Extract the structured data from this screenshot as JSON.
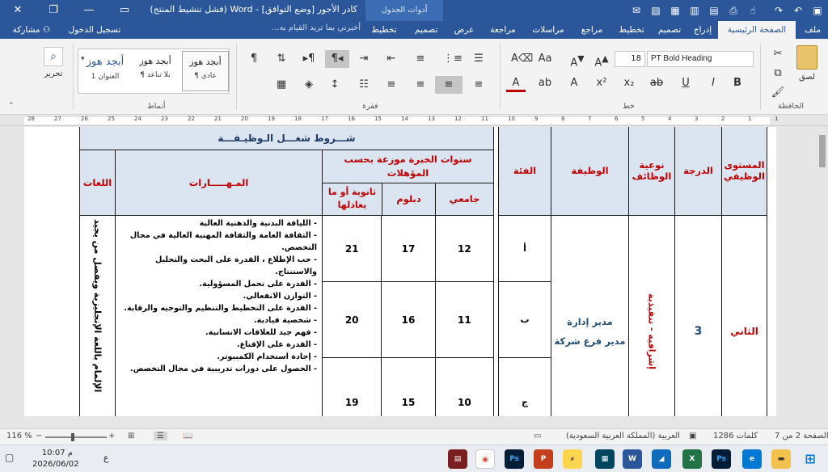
{
  "titlebar": {
    "doc_title": "كادر الأجور [وضع التوافق] - Word (فشل تنشيط المنتج)",
    "context_group": "أدوات الجدول",
    "icons": [
      "restore-icon",
      "minimize-icon",
      "ribbon-display-icon",
      "close-icon"
    ]
  },
  "tabs": {
    "file": "ملف",
    "home": "الصفحة الرئيسية",
    "insert": "إدراج",
    "design": "تصميم",
    "layout": "تخطيط",
    "references": "مراجع",
    "mailings": "مراسلات",
    "review": "مراجعة",
    "view": "عرض",
    "table_design": "تصميم",
    "table_layout": "تخطيط",
    "tell_me": "أخبرني بما تريد القيام به...",
    "signin": "تسجيل الدخول",
    "share": "مشاركة"
  },
  "ribbon": {
    "clipboard_label": "الحافظة",
    "paste_label": "لصق",
    "font_label": "خط",
    "paragraph_label": "فقرة",
    "styles_label": "أنماط",
    "editing_label": "تحرير",
    "font_name": "PT Bold Heading",
    "font_size": "18",
    "styles": [
      {
        "preview": "أبجد هوز",
        "name": "¶ عادي"
      },
      {
        "preview": "أبجد هوز",
        "name": "¶ بلا تباعد"
      },
      {
        "preview": "أبجد هوز",
        "name": "العنوان 1"
      }
    ]
  },
  "ruler": {
    "numbers": [
      "28",
      "27",
      "26",
      "25",
      "24",
      "23",
      "22",
      "21",
      "20",
      "19",
      "18",
      "17",
      "16",
      "15",
      "14",
      "13",
      "12",
      "11",
      "10",
      "9",
      "8",
      "7",
      "6",
      "5",
      "4",
      "3",
      "2",
      "1",
      "1"
    ]
  },
  "table": {
    "conditions_title": "شـــروط شغـــل الـوظيـفـــة",
    "headers": {
      "level": "المستوى الوظيفي",
      "grade": "الدرجة",
      "job_type": "نوعية الوظائف",
      "job": "الوظيفة",
      "category": "الفئة",
      "experience": "سنوات الخبرة موزعة بحسب المؤهلات",
      "university": "جامعي",
      "diploma": "دبلوم",
      "secondary": "ثانوية أو ما يعادلها",
      "skills": "المـهـــــارات",
      "languages": "اللغات"
    },
    "row": {
      "level": "الثاني",
      "grade": "3",
      "job_type": "إشرافية - تنفيذية",
      "jobs": [
        "مدير إدارة",
        "مدير فرع شركة"
      ],
      "languages": "الإلمام باللغة الإنجليزية ويفضل من يجيد"
    },
    "categories": [
      {
        "cat": "أ",
        "university": "12",
        "diploma": "17",
        "secondary": "21"
      },
      {
        "cat": "ب",
        "university": "11",
        "diploma": "16",
        "secondary": "20"
      },
      {
        "cat": "ج",
        "university": "10",
        "diploma": "15",
        "secondary": "19"
      }
    ],
    "skills": [
      "- اللياقة البدنية والذهنية العالية",
      "- الثقافة العامة والثقافة المهنية العالية في مجال التخصص.",
      "- حب الإطلاع ، القدرة على البحث والتحليل والاستنتاج.",
      "- القدرة على تحمل المسؤولية.",
      "- التوازن الانفعالي.",
      "- القدرة على التخطيط والتنظيم والتوجيه والرقابة.",
      "- شخصية قيادية.",
      "- فهم جيد للعلاقات الانسانية.",
      "- القدرة على الإقناع.",
      "- إجادة استخدام الكمبيوتر.",
      "- الحصول على دورات تدريبية في مجال التخصص."
    ]
  },
  "statusbar": {
    "page": "الصفحة 2 من 7",
    "words": "1286 كلمات",
    "language": "العربية (المملكة العربية السعودية)",
    "zoom": "116 %"
  },
  "taskbar": {
    "time": "10:07 م",
    "date": "2026/06/02",
    "lang_indicator": "ع"
  }
}
